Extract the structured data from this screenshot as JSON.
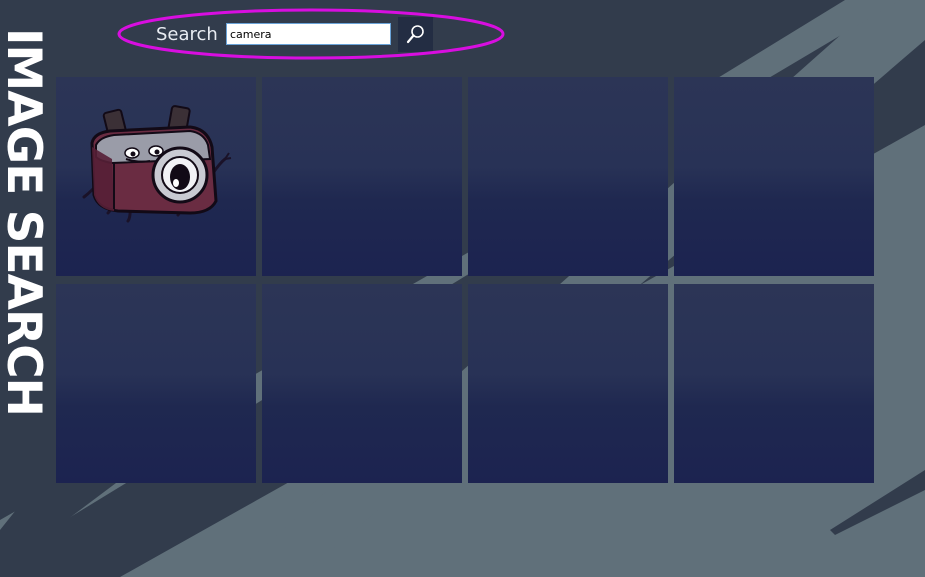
{
  "app": {
    "title": "IMAGE SEARCH"
  },
  "search": {
    "label": "Search",
    "query": "camera",
    "button_icon": "magnifier-icon"
  },
  "results": [
    {
      "icon": "camera-mascot-image",
      "has_image": true
    },
    {
      "has_image": false
    },
    {
      "has_image": false
    },
    {
      "has_image": false
    },
    {
      "has_image": false
    },
    {
      "has_image": false
    },
    {
      "has_image": false
    },
    {
      "has_image": false
    }
  ],
  "colors": {
    "background": "#323c4c",
    "stripe": "#60707a",
    "tile": "#262f55",
    "highlight": "#d80ee0",
    "input_border": "#6aa3d8"
  }
}
